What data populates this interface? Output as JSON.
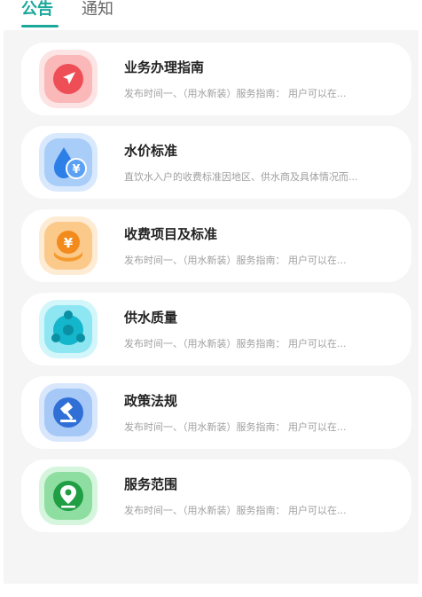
{
  "tabs": {
    "notice_label": "公告",
    "notification_label": "通知"
  },
  "colors": {
    "accent": "#1ba89a",
    "page_background": "#f5f5f5",
    "card_background": "#ffffff"
  },
  "items": [
    {
      "title": "业务办理指南",
      "description": "发布时间一、（用水新装）服务指南： 用户可以在...",
      "icon": "navigation-arrow-icon",
      "icon_color": "#f06a6a"
    },
    {
      "title": "水价标准",
      "description": "直饮水入户的收费标准因地区、供水商及具体情况而...",
      "icon": "water-drop-yen-icon",
      "icon_color": "#3f8ff0"
    },
    {
      "title": "收费项目及标准",
      "description": "发布时间一、（用水新装）服务指南： 用户可以在...",
      "icon": "yen-coin-hand-icon",
      "icon_color": "#f59a2e"
    },
    {
      "title": "供水质量",
      "description": "发布时间一、（用水新装）服务指南： 用户可以在...",
      "icon": "water-molecule-icon",
      "icon_color": "#25c7dc"
    },
    {
      "title": "政策法规",
      "description": "发布时间一、（用水新装）服务指南： 用户可以在...",
      "icon": "gavel-icon",
      "icon_color": "#3f83e8"
    },
    {
      "title": "服务范围",
      "description": "发布时间一、（用水新装）服务指南： 用户可以在...",
      "icon": "location-pin-icon",
      "icon_color": "#2fb455"
    }
  ]
}
